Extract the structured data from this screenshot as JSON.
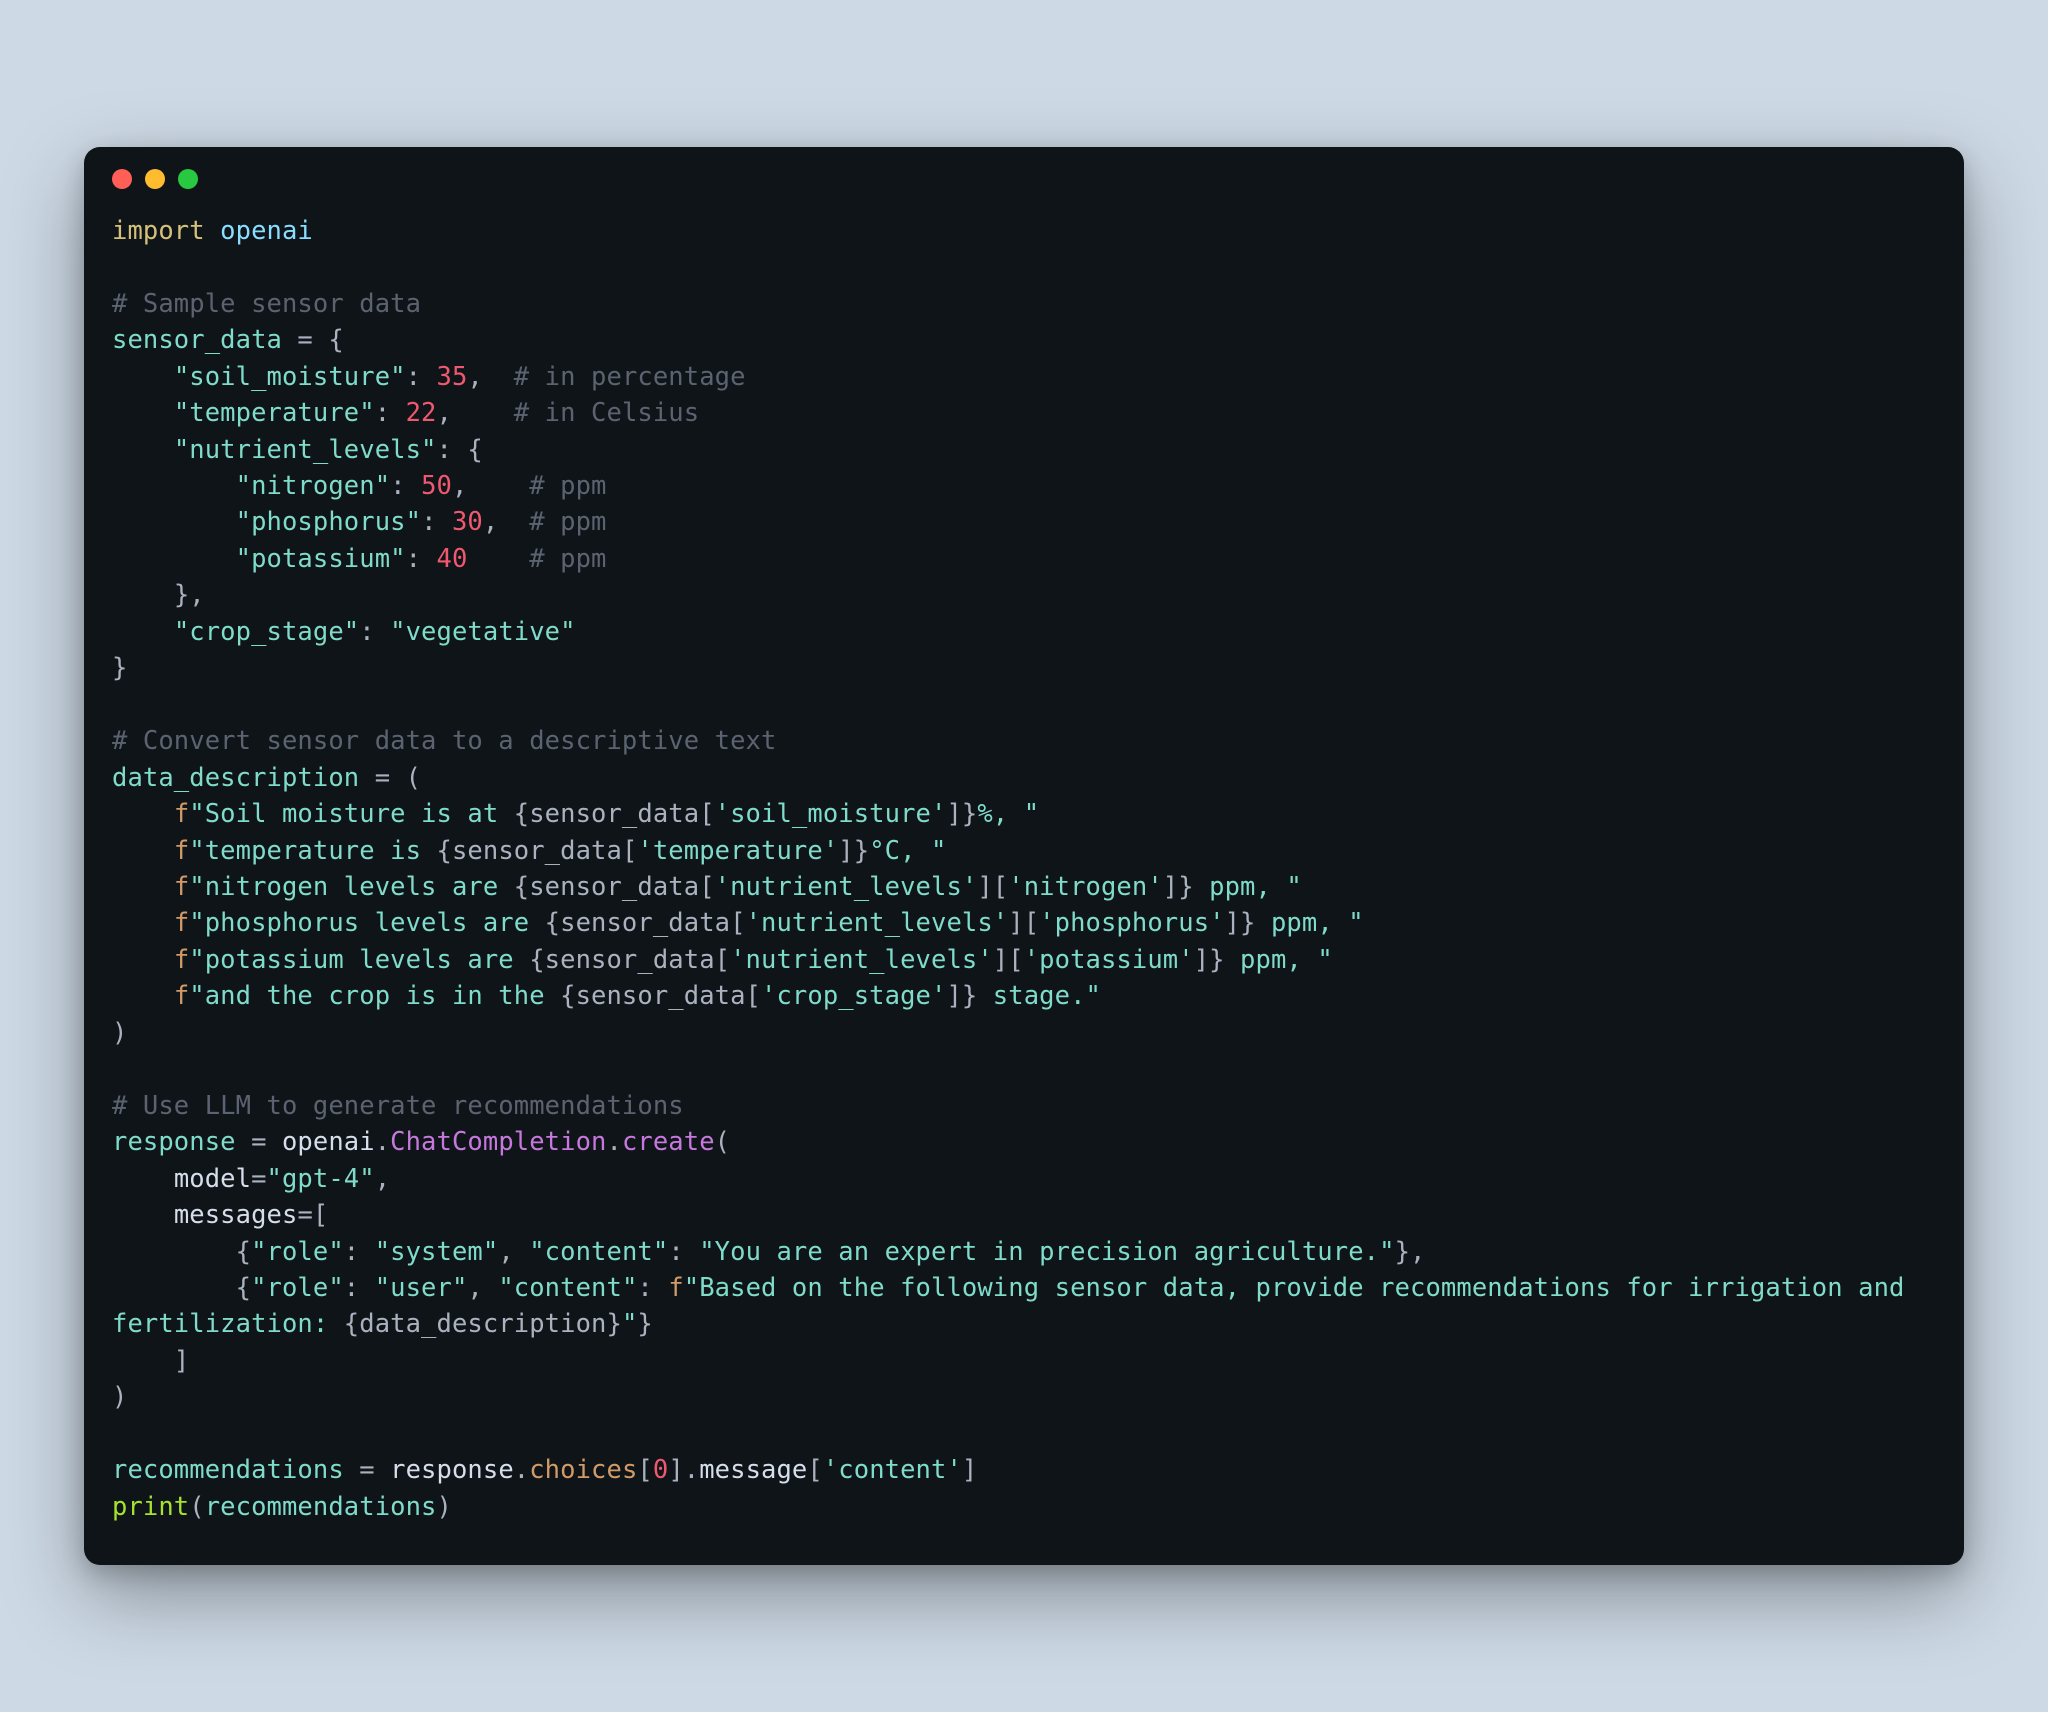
{
  "window": {
    "dots": {
      "red": "#ff5f57",
      "yellow": "#febc2e",
      "green": "#28c840"
    }
  },
  "code": {
    "l01_import": "import",
    "l01_mod": "openai",
    "l03_cm": "# Sample sensor data",
    "l04_var": "sensor_data",
    "l04_eq": " = {",
    "l05_key": "\"soil_moisture\"",
    "l05_colon": ": ",
    "l05_val": "35",
    "l05_comma": ",  ",
    "l05_cm": "# in percentage",
    "l06_key": "\"temperature\"",
    "l06_val": "22",
    "l06_comma": ",    ",
    "l06_cm": "# in Celsius",
    "l07_key": "\"nutrient_levels\"",
    "l07_rest": ": {",
    "l08_key": "\"nitrogen\"",
    "l08_val": "50",
    "l08_comma": ",    ",
    "l08_cm": "# ppm",
    "l09_key": "\"phosphorus\"",
    "l09_val": "30",
    "l09_comma": ",  ",
    "l09_cm": "# ppm",
    "l10_key": "\"potassium\"",
    "l10_val": "40",
    "l10_sp": "    ",
    "l10_cm": "# ppm",
    "l11": "    },",
    "l12_key": "\"crop_stage\"",
    "l12_val": "\"vegetative\"",
    "l13": "}",
    "l15_cm": "# Convert sensor data to a descriptive text",
    "l16_var": "data_description",
    "l16_eq": " = (",
    "l17_f": "f",
    "l17_a": "\"Soil moisture is at ",
    "l17_b": "{sensor_data[",
    "l17_c": "'soil_moisture'",
    "l17_d": "]}",
    "l17_e": "%, \"",
    "l18_a": "\"temperature is ",
    "l18_b": "{sensor_data[",
    "l18_c": "'temperature'",
    "l18_d": "]}",
    "l18_e": "°C, \"",
    "l19_a": "\"nitrogen levels are ",
    "l19_b": "{sensor_data[",
    "l19_c": "'nutrient_levels'",
    "l19_d": "][",
    "l19_e": "'nitrogen'",
    "l19_f": "]}",
    "l19_g": " ppm, \"",
    "l20_a": "\"phosphorus levels are ",
    "l20_b": "{sensor_data[",
    "l20_c": "'nutrient_levels'",
    "l20_d": "][",
    "l20_e": "'phosphorus'",
    "l20_f": "]}",
    "l20_g": " ppm, \"",
    "l21_a": "\"potassium levels are ",
    "l21_b": "{sensor_data[",
    "l21_c": "'nutrient_levels'",
    "l21_d": "][",
    "l21_e": "'potassium'",
    "l21_f": "]}",
    "l21_g": " ppm, \"",
    "l22_a": "\"and the crop is in the ",
    "l22_b": "{sensor_data[",
    "l22_c": "'crop_stage'",
    "l22_d": "]}",
    "l22_e": " stage.\"",
    "l23": ")",
    "l25_cm": "# Use LLM to generate recommendations",
    "l26_var": "response",
    "l26_eq": " = ",
    "l26_mod": "openai",
    "l26_dot1": ".",
    "l26_fn1": "ChatCompletion",
    "l26_dot2": ".",
    "l26_fn2": "create",
    "l26_open": "(",
    "l27_k": "model",
    "l27_eq": "=",
    "l27_v": "\"gpt-4\"",
    "l27_c": ",",
    "l28_k": "messages",
    "l28_eq": "=",
    "l28_v": "[",
    "l29_open": "{",
    "l29_k1": "\"role\"",
    "l29_v1": "\"system\"",
    "l29_k2": "\"content\"",
    "l29_v2": "\"You are an expert in precision agriculture.\"",
    "l29_close": "},",
    "l30_open": "{",
    "l30_k1": "\"role\"",
    "l30_v1": "\"user\"",
    "l30_k2": "\"content\"",
    "l30_f": "f",
    "l30_a": "\"Based on the following sensor data, provide recommendations for irrigation and fertilization: ",
    "l30_b": "{data_description}",
    "l30_c": "\"",
    "l30_close": "}",
    "l31": "    ]",
    "l32": ")",
    "l34_var": "recommendations",
    "l34_eq": " = ",
    "l34_a": "response",
    "l34_dot1": ".",
    "l34_b": "choices",
    "l34_open": "[",
    "l34_idx": "0",
    "l34_close": "]",
    "l34_dot2": ".",
    "l34_c": "message",
    "l34_open2": "[",
    "l34_key": "'content'",
    "l34_close2": "]",
    "l35_fn": "print",
    "l35_open": "(",
    "l35_arg": "recommendations",
    "l35_close": ")"
  }
}
